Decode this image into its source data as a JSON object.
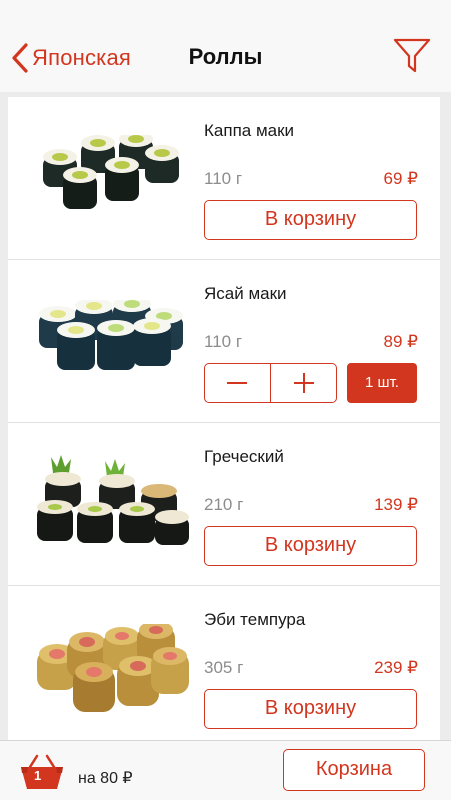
{
  "nav": {
    "back_label": "Японская",
    "title": "Роллы"
  },
  "items": [
    {
      "name": "Каппа маки",
      "weight": "110 г",
      "price": "69 ₽",
      "button": "В корзину"
    },
    {
      "name": "Ясай маки",
      "weight": "110 г",
      "price": "89 ₽",
      "quantity": "1 шт."
    },
    {
      "name": "Греческий",
      "weight": "210 г",
      "price": "139 ₽",
      "button": "В корзину"
    },
    {
      "name": "Эби темпура",
      "weight": "305 г",
      "price": "239 ₽",
      "button": "В корзину"
    }
  ],
  "footer": {
    "count": "1",
    "total": "на 80 ₽",
    "cart_label": "Корзина"
  },
  "colors": {
    "accent": "#d2361f",
    "background": "#ececec"
  }
}
